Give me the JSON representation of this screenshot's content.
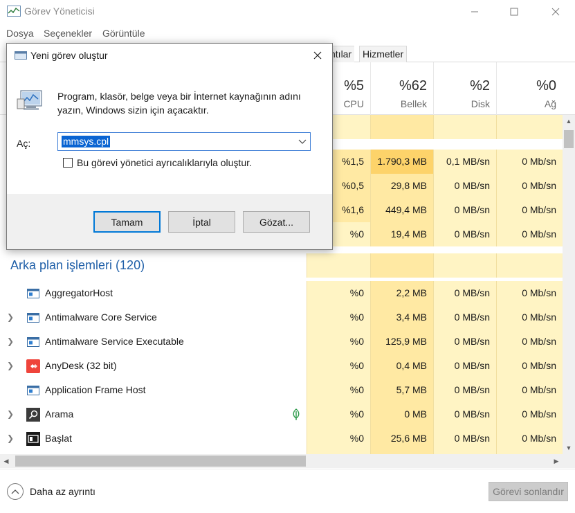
{
  "window": {
    "title": "Görev Yöneticisi",
    "controls": {
      "minimize": "—",
      "maximize": "☐",
      "close": "✕"
    }
  },
  "menu": [
    "Dosya",
    "Seçenekler",
    "Görüntüle"
  ],
  "tabs": [
    "ntılar",
    "Hizmetler"
  ],
  "columns": [
    {
      "pct": "%5",
      "label": "CPU"
    },
    {
      "pct": "%62",
      "label": "Bellek"
    },
    {
      "pct": "%2",
      "label": "Disk"
    },
    {
      "pct": "%0",
      "label": "Ağ"
    }
  ],
  "visible_rows_top": [
    {
      "cpu": "%1,5",
      "memory": "1.790,3 MB",
      "disk": "0,1 MB/sn",
      "network": "0 Mb/sn"
    },
    {
      "cpu": "%0,5",
      "memory": "29,8 MB",
      "disk": "0 MB/sn",
      "network": "0 Mb/sn"
    },
    {
      "cpu": "%1,6",
      "memory": "449,4 MB",
      "disk": "0 MB/sn",
      "network": "0 Mb/sn"
    },
    {
      "cpu": "%0",
      "memory": "19,4 MB",
      "disk": "0 MB/sn",
      "network": "0 Mb/sn"
    }
  ],
  "background_section": {
    "title": "Arka plan işlemleri (120)",
    "processes": [
      {
        "name": "AggregatorHost",
        "icon": "app-window-icon",
        "expandable": false,
        "cpu": "%0",
        "memory": "2,2 MB",
        "disk": "0 MB/sn",
        "network": "0 Mb/sn"
      },
      {
        "name": "Antimalware Core Service",
        "icon": "app-window-icon",
        "expandable": true,
        "cpu": "%0",
        "memory": "3,4 MB",
        "disk": "0 MB/sn",
        "network": "0 Mb/sn"
      },
      {
        "name": "Antimalware Service Executable",
        "icon": "app-window-icon",
        "expandable": true,
        "cpu": "%0",
        "memory": "125,9 MB",
        "disk": "0 MB/sn",
        "network": "0 Mb/sn"
      },
      {
        "name": "AnyDesk (32 bit)",
        "icon": "anydesk-icon",
        "expandable": true,
        "cpu": "%0",
        "memory": "0,4 MB",
        "disk": "0 MB/sn",
        "network": "0 Mb/sn"
      },
      {
        "name": "Application Frame Host",
        "icon": "app-window-icon",
        "expandable": false,
        "cpu": "%0",
        "memory": "5,7 MB",
        "disk": "0 MB/sn",
        "network": "0 Mb/sn"
      },
      {
        "name": "Arama",
        "icon": "search-icon",
        "expandable": true,
        "suspended_leaf": true,
        "cpu": "%0",
        "memory": "0 MB",
        "disk": "0 MB/sn",
        "network": "0 Mb/sn"
      },
      {
        "name": "Başlat",
        "icon": "start-icon",
        "expandable": true,
        "cpu": "%0",
        "memory": "25,6 MB",
        "disk": "0 MB/sn",
        "network": "0 Mb/sn"
      }
    ]
  },
  "footer": {
    "fewer_details": "Daha az ayrıntı",
    "end_task": "Görevi sonlandır"
  },
  "dialog": {
    "title": "Yeni görev oluştur",
    "description": "Program, klasör, belge veya bir İnternet kaynağının adını yazın, Windows sizin için açacaktır.",
    "open_label": "Aç:",
    "open_value": "mmsys.cpl",
    "checkbox_label": "Bu görevi yönetici ayrıcalıklarıyla oluştur.",
    "ok": "Tamam",
    "cancel": "İptal",
    "browse": "Gözat..."
  }
}
